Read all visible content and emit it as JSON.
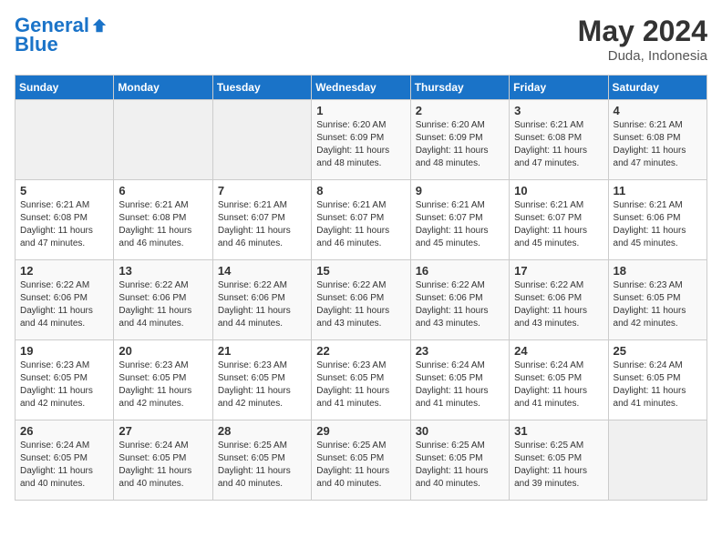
{
  "header": {
    "logo_line1": "General",
    "logo_line2": "Blue",
    "month": "May 2024",
    "location": "Duda, Indonesia"
  },
  "weekdays": [
    "Sunday",
    "Monday",
    "Tuesday",
    "Wednesday",
    "Thursday",
    "Friday",
    "Saturday"
  ],
  "weeks": [
    [
      {
        "day": "",
        "info": ""
      },
      {
        "day": "",
        "info": ""
      },
      {
        "day": "",
        "info": ""
      },
      {
        "day": "1",
        "info": "Sunrise: 6:20 AM\nSunset: 6:09 PM\nDaylight: 11 hours\nand 48 minutes."
      },
      {
        "day": "2",
        "info": "Sunrise: 6:20 AM\nSunset: 6:09 PM\nDaylight: 11 hours\nand 48 minutes."
      },
      {
        "day": "3",
        "info": "Sunrise: 6:21 AM\nSunset: 6:08 PM\nDaylight: 11 hours\nand 47 minutes."
      },
      {
        "day": "4",
        "info": "Sunrise: 6:21 AM\nSunset: 6:08 PM\nDaylight: 11 hours\nand 47 minutes."
      }
    ],
    [
      {
        "day": "5",
        "info": "Sunrise: 6:21 AM\nSunset: 6:08 PM\nDaylight: 11 hours\nand 47 minutes."
      },
      {
        "day": "6",
        "info": "Sunrise: 6:21 AM\nSunset: 6:08 PM\nDaylight: 11 hours\nand 46 minutes."
      },
      {
        "day": "7",
        "info": "Sunrise: 6:21 AM\nSunset: 6:07 PM\nDaylight: 11 hours\nand 46 minutes."
      },
      {
        "day": "8",
        "info": "Sunrise: 6:21 AM\nSunset: 6:07 PM\nDaylight: 11 hours\nand 46 minutes."
      },
      {
        "day": "9",
        "info": "Sunrise: 6:21 AM\nSunset: 6:07 PM\nDaylight: 11 hours\nand 45 minutes."
      },
      {
        "day": "10",
        "info": "Sunrise: 6:21 AM\nSunset: 6:07 PM\nDaylight: 11 hours\nand 45 minutes."
      },
      {
        "day": "11",
        "info": "Sunrise: 6:21 AM\nSunset: 6:06 PM\nDaylight: 11 hours\nand 45 minutes."
      }
    ],
    [
      {
        "day": "12",
        "info": "Sunrise: 6:22 AM\nSunset: 6:06 PM\nDaylight: 11 hours\nand 44 minutes."
      },
      {
        "day": "13",
        "info": "Sunrise: 6:22 AM\nSunset: 6:06 PM\nDaylight: 11 hours\nand 44 minutes."
      },
      {
        "day": "14",
        "info": "Sunrise: 6:22 AM\nSunset: 6:06 PM\nDaylight: 11 hours\nand 44 minutes."
      },
      {
        "day": "15",
        "info": "Sunrise: 6:22 AM\nSunset: 6:06 PM\nDaylight: 11 hours\nand 43 minutes."
      },
      {
        "day": "16",
        "info": "Sunrise: 6:22 AM\nSunset: 6:06 PM\nDaylight: 11 hours\nand 43 minutes."
      },
      {
        "day": "17",
        "info": "Sunrise: 6:22 AM\nSunset: 6:06 PM\nDaylight: 11 hours\nand 43 minutes."
      },
      {
        "day": "18",
        "info": "Sunrise: 6:23 AM\nSunset: 6:05 PM\nDaylight: 11 hours\nand 42 minutes."
      }
    ],
    [
      {
        "day": "19",
        "info": "Sunrise: 6:23 AM\nSunset: 6:05 PM\nDaylight: 11 hours\nand 42 minutes."
      },
      {
        "day": "20",
        "info": "Sunrise: 6:23 AM\nSunset: 6:05 PM\nDaylight: 11 hours\nand 42 minutes."
      },
      {
        "day": "21",
        "info": "Sunrise: 6:23 AM\nSunset: 6:05 PM\nDaylight: 11 hours\nand 42 minutes."
      },
      {
        "day": "22",
        "info": "Sunrise: 6:23 AM\nSunset: 6:05 PM\nDaylight: 11 hours\nand 41 minutes."
      },
      {
        "day": "23",
        "info": "Sunrise: 6:24 AM\nSunset: 6:05 PM\nDaylight: 11 hours\nand 41 minutes."
      },
      {
        "day": "24",
        "info": "Sunrise: 6:24 AM\nSunset: 6:05 PM\nDaylight: 11 hours\nand 41 minutes."
      },
      {
        "day": "25",
        "info": "Sunrise: 6:24 AM\nSunset: 6:05 PM\nDaylight: 11 hours\nand 41 minutes."
      }
    ],
    [
      {
        "day": "26",
        "info": "Sunrise: 6:24 AM\nSunset: 6:05 PM\nDaylight: 11 hours\nand 40 minutes."
      },
      {
        "day": "27",
        "info": "Sunrise: 6:24 AM\nSunset: 6:05 PM\nDaylight: 11 hours\nand 40 minutes."
      },
      {
        "day": "28",
        "info": "Sunrise: 6:25 AM\nSunset: 6:05 PM\nDaylight: 11 hours\nand 40 minutes."
      },
      {
        "day": "29",
        "info": "Sunrise: 6:25 AM\nSunset: 6:05 PM\nDaylight: 11 hours\nand 40 minutes."
      },
      {
        "day": "30",
        "info": "Sunrise: 6:25 AM\nSunset: 6:05 PM\nDaylight: 11 hours\nand 40 minutes."
      },
      {
        "day": "31",
        "info": "Sunrise: 6:25 AM\nSunset: 6:05 PM\nDaylight: 11 hours\nand 39 minutes."
      },
      {
        "day": "",
        "info": ""
      }
    ]
  ]
}
